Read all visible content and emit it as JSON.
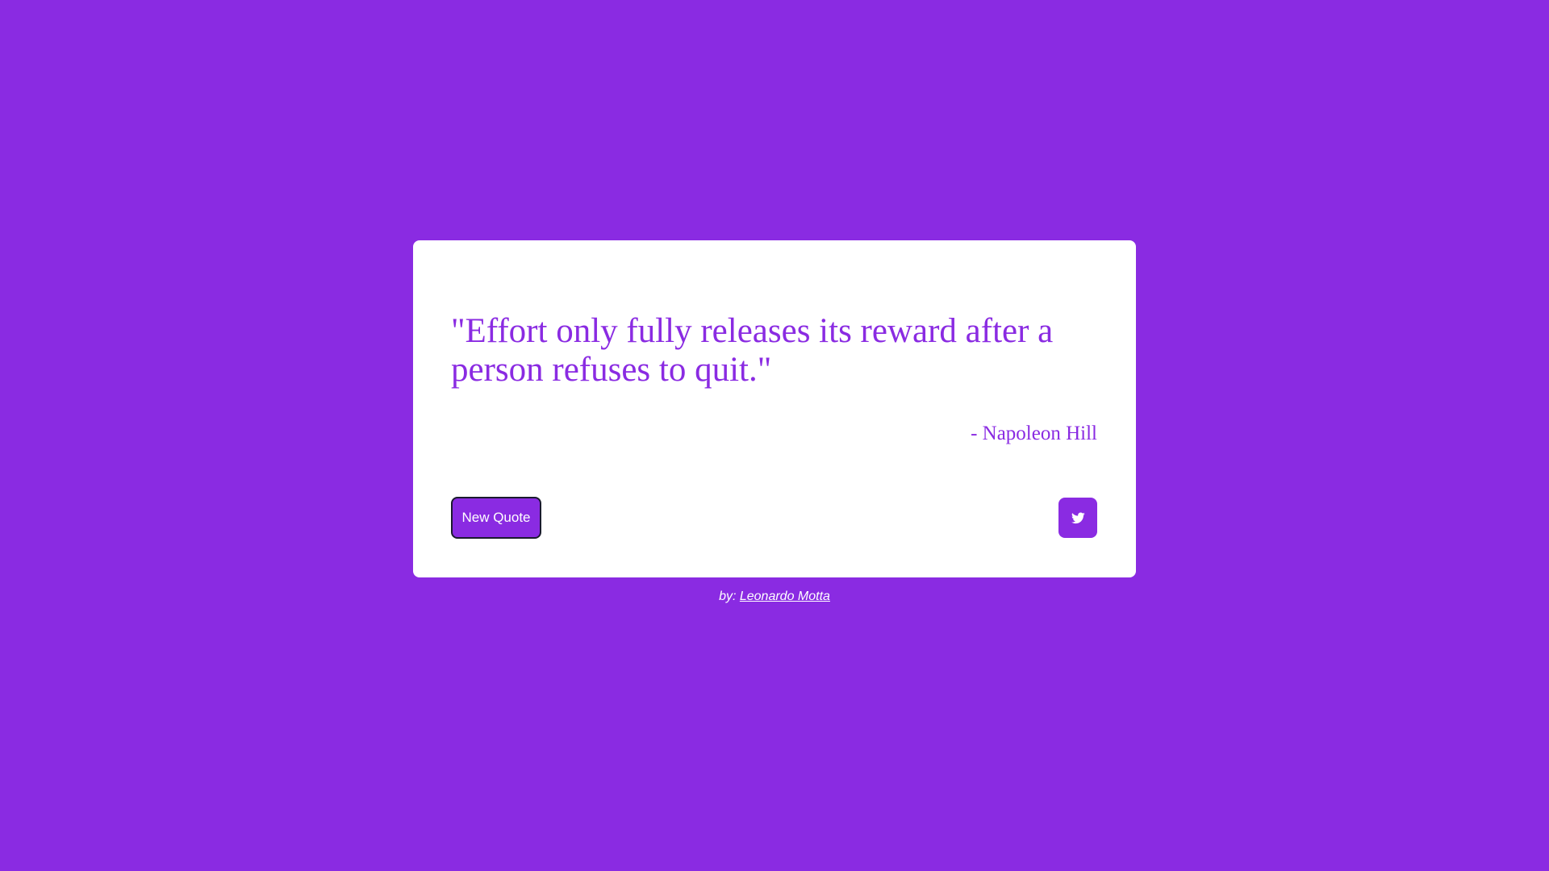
{
  "quote": {
    "text": "\"Effort only fully releases its reward after a person refuses to quit.\"",
    "author": "- Napoleon Hill"
  },
  "actions": {
    "new_quote_label": "New Quote",
    "tweet_icon": "twitter-icon"
  },
  "footer": {
    "prefix": "by: ",
    "link_text": "Leonardo Motta"
  },
  "colors": {
    "background": "#8a2be2",
    "card": "#ffffff",
    "accent": "#8a2be2"
  }
}
